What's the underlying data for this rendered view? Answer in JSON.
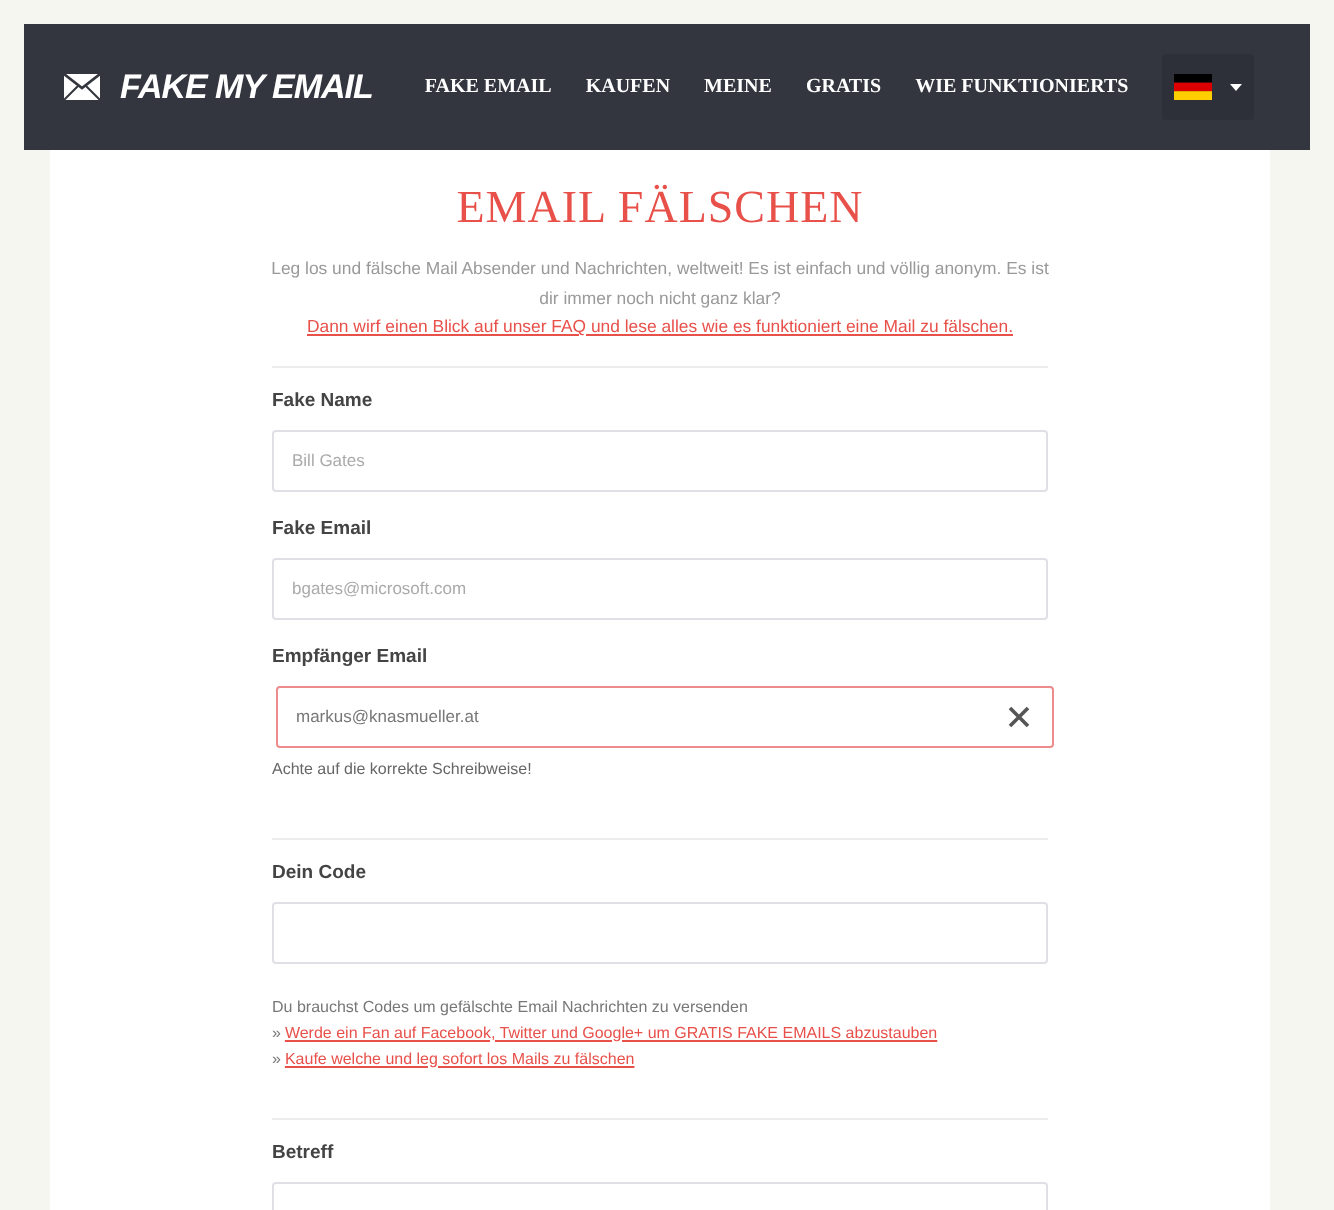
{
  "nav": {
    "logo": "FAKE MY EMAIL",
    "items": [
      {
        "label": "FAKE EMAIL"
      },
      {
        "label": "KAUFEN"
      },
      {
        "label": "MEINE"
      },
      {
        "label": "GRATIS"
      },
      {
        "label": "WIE FUNKTIONIERTS"
      }
    ],
    "language_button": {
      "expanded": false
    }
  },
  "title": "EMAIL FÄLSCHEN",
  "intro": {
    "text": "Leg los und fälsche Mail Absender und Nachrichten, weltweit! Es ist einfach und völlig anonym. Es ist dir immer noch nicht ganz klar?",
    "link": "Dann wirf einen Blick auf unser FAQ und lese alles wie es funktioniert eine Mail zu fälschen."
  },
  "sections": [
    {
      "fields": [
        {
          "label": "Fake Name",
          "placeholder": "Bill Gates",
          "error": false
        },
        {
          "label": "Fake Email",
          "placeholder": "bgates@microsoft.com",
          "error": false
        },
        {
          "label": "Empfänger Email",
          "value": "markus@knasmueller.at",
          "error": true,
          "clearable": true,
          "hint": "Achte auf die korrekte Schreibweise!"
        }
      ]
    },
    {
      "fields": [
        {
          "label": "Dein Code",
          "error": false
        }
      ],
      "help": {
        "text": "Du brauchst Codes um gefälschte Email Nachrichten zu versenden",
        "links": [
          {
            "bullet": "»",
            "text": "Werde ein Fan auf Facebook, Twitter und Google+ um GRATIS FAKE EMAILS abzustauben"
          },
          {
            "bullet": "»",
            "text": "Kaufe welche und leg sofort los Mails zu fälschen"
          }
        ]
      }
    },
    {
      "fields": [
        {
          "label": "Betreff",
          "error": false
        }
      ]
    }
  ]
}
